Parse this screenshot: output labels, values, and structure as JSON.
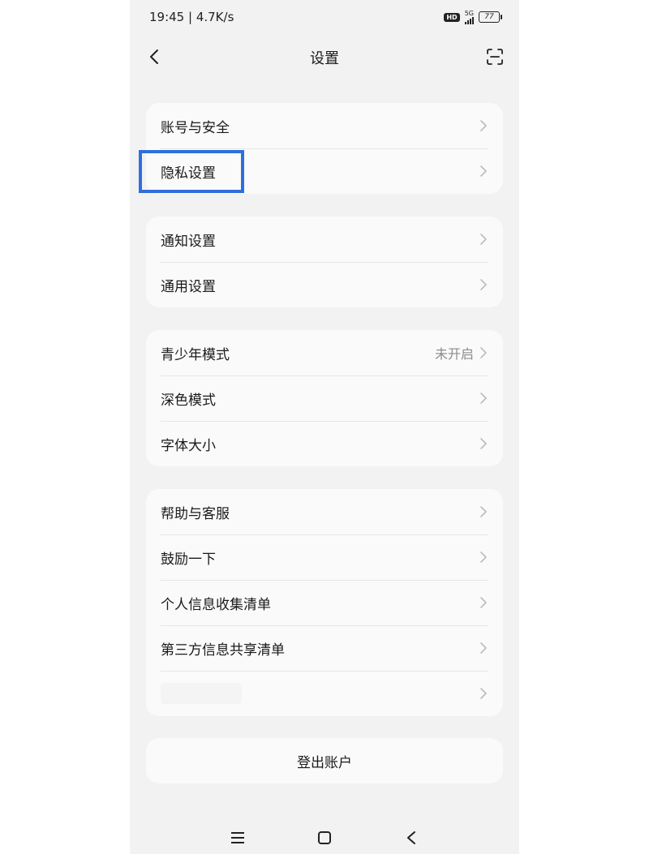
{
  "status_bar": {
    "time_speed": "19:45 | 4.7K/s",
    "hd_label": "HD",
    "network_label": "5G",
    "battery_level": "77"
  },
  "header": {
    "title": "设置",
    "back_icon": "chevron-left-icon",
    "scan_icon": "scan-icon"
  },
  "groups": [
    {
      "items": [
        {
          "label": "账号与安全",
          "value": ""
        },
        {
          "label": "隐私设置",
          "value": ""
        }
      ]
    },
    {
      "items": [
        {
          "label": "通知设置",
          "value": ""
        },
        {
          "label": "通用设置",
          "value": ""
        }
      ]
    },
    {
      "items": [
        {
          "label": "青少年模式",
          "value": "未开启"
        },
        {
          "label": "深色模式",
          "value": ""
        },
        {
          "label": "字体大小",
          "value": ""
        }
      ]
    },
    {
      "items": [
        {
          "label": "帮助与客服",
          "value": ""
        },
        {
          "label": "鼓励一下",
          "value": ""
        },
        {
          "label": "个人信息收集清单",
          "value": ""
        },
        {
          "label": "第三方信息共享清单",
          "value": ""
        },
        {
          "label": "",
          "value": ""
        }
      ]
    }
  ],
  "logout_label": "登出账户",
  "highlight_color": "#2f6fdc",
  "system_nav": {
    "menu_icon": "menu-icon",
    "home_icon": "home-square-icon",
    "back_icon": "back-triangle-icon"
  }
}
